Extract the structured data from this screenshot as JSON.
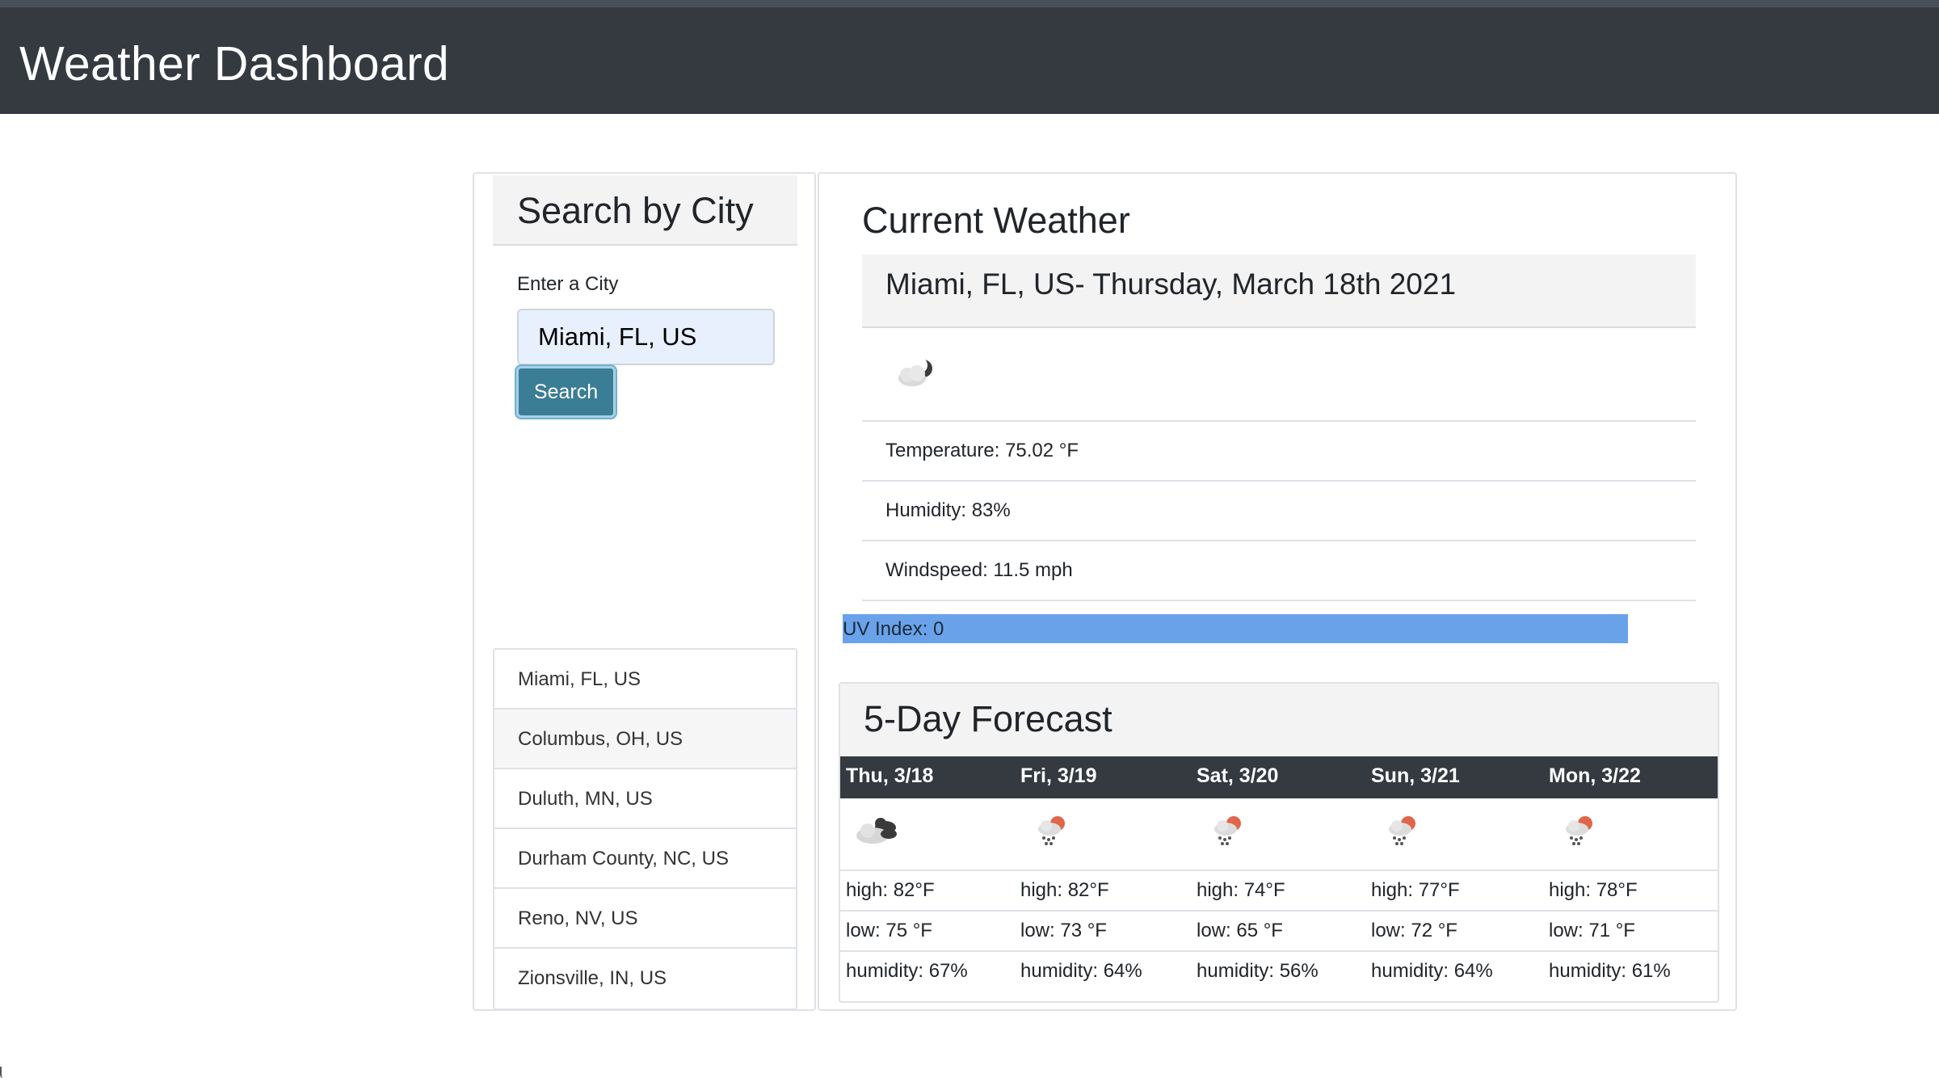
{
  "header": {
    "title": "Weather Dashboard"
  },
  "search": {
    "title": "Search by City",
    "input_label": "Enter a City",
    "input_value": "Miami, FL, US",
    "button_label": "Search",
    "history": [
      "Miami, FL, US",
      "Columbus, OH, US",
      "Duluth, MN, US",
      "Durham County, NC, US",
      "Reno, NV, US",
      "Zionsville, IN, US"
    ]
  },
  "current": {
    "title": "Current Weather",
    "location_date": "Miami, FL, US- Thursday, March 18th 2021",
    "icon": "partly-cloudy-night-icon",
    "temperature": "Temperature: 75.02 °F",
    "humidity": "Humidity: 83%",
    "windspeed": "Windspeed: 11.5 mph",
    "uv_index": "UV Index: 0",
    "uv_color": "#6aa2ea"
  },
  "forecast": {
    "title": "5-Day Forecast",
    "days": [
      {
        "day": "Thu, 3/18",
        "icon": "broken-clouds-icon",
        "high": "high: 82°F",
        "low": "low: 75 °F",
        "humidity": "humidity: 67%"
      },
      {
        "day": "Fri, 3/19",
        "icon": "rain-icon",
        "high": "high: 82°F",
        "low": "low: 73 °F",
        "humidity": "humidity: 64%"
      },
      {
        "day": "Sat, 3/20",
        "icon": "rain-icon",
        "high": "high: 74°F",
        "low": "low: 65 °F",
        "humidity": "humidity: 56%"
      },
      {
        "day": "Sun, 3/21",
        "icon": "rain-icon",
        "high": "high: 77°F",
        "low": "low: 72 °F",
        "humidity": "humidity: 64%"
      },
      {
        "day": "Mon, 3/22",
        "icon": "rain-icon",
        "high": "high: 78°F",
        "low": "low: 71 °F",
        "humidity": "humidity: 61%"
      }
    ]
  }
}
